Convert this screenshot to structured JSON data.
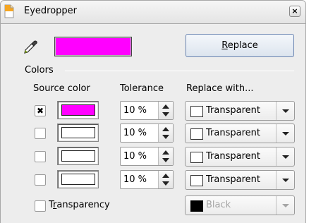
{
  "window": {
    "title": "Eyedropper",
    "close_glyph": "×"
  },
  "top": {
    "preview_color": "#ff00ff",
    "replace_button": "Replace"
  },
  "colors": {
    "section_label": "Colors",
    "headers": {
      "source": "Source color",
      "tolerance": "Tolerance",
      "replace_with": "Replace with..."
    },
    "rows": [
      {
        "checked": true,
        "check_glyph": "✖",
        "source_color": "#ff00ff",
        "tolerance": "10 %",
        "replace": "Transparent"
      },
      {
        "checked": false,
        "check_glyph": "",
        "source_color": "#ffffff",
        "tolerance": "10 %",
        "replace": "Transparent"
      },
      {
        "checked": false,
        "check_glyph": "",
        "source_color": "#ffffff",
        "tolerance": "10 %",
        "replace": "Transparent"
      },
      {
        "checked": false,
        "check_glyph": "",
        "source_color": "#ffffff",
        "tolerance": "10 %",
        "replace": "Transparent"
      }
    ]
  },
  "transparency": {
    "label_pre": "T",
    "label_mnemonic": "r",
    "label_post": "ansparency",
    "checked": false,
    "replace_color": "Black"
  },
  "icons": {
    "app": "app-icon",
    "dropper": "eyedropper-icon",
    "close": "close-icon"
  }
}
